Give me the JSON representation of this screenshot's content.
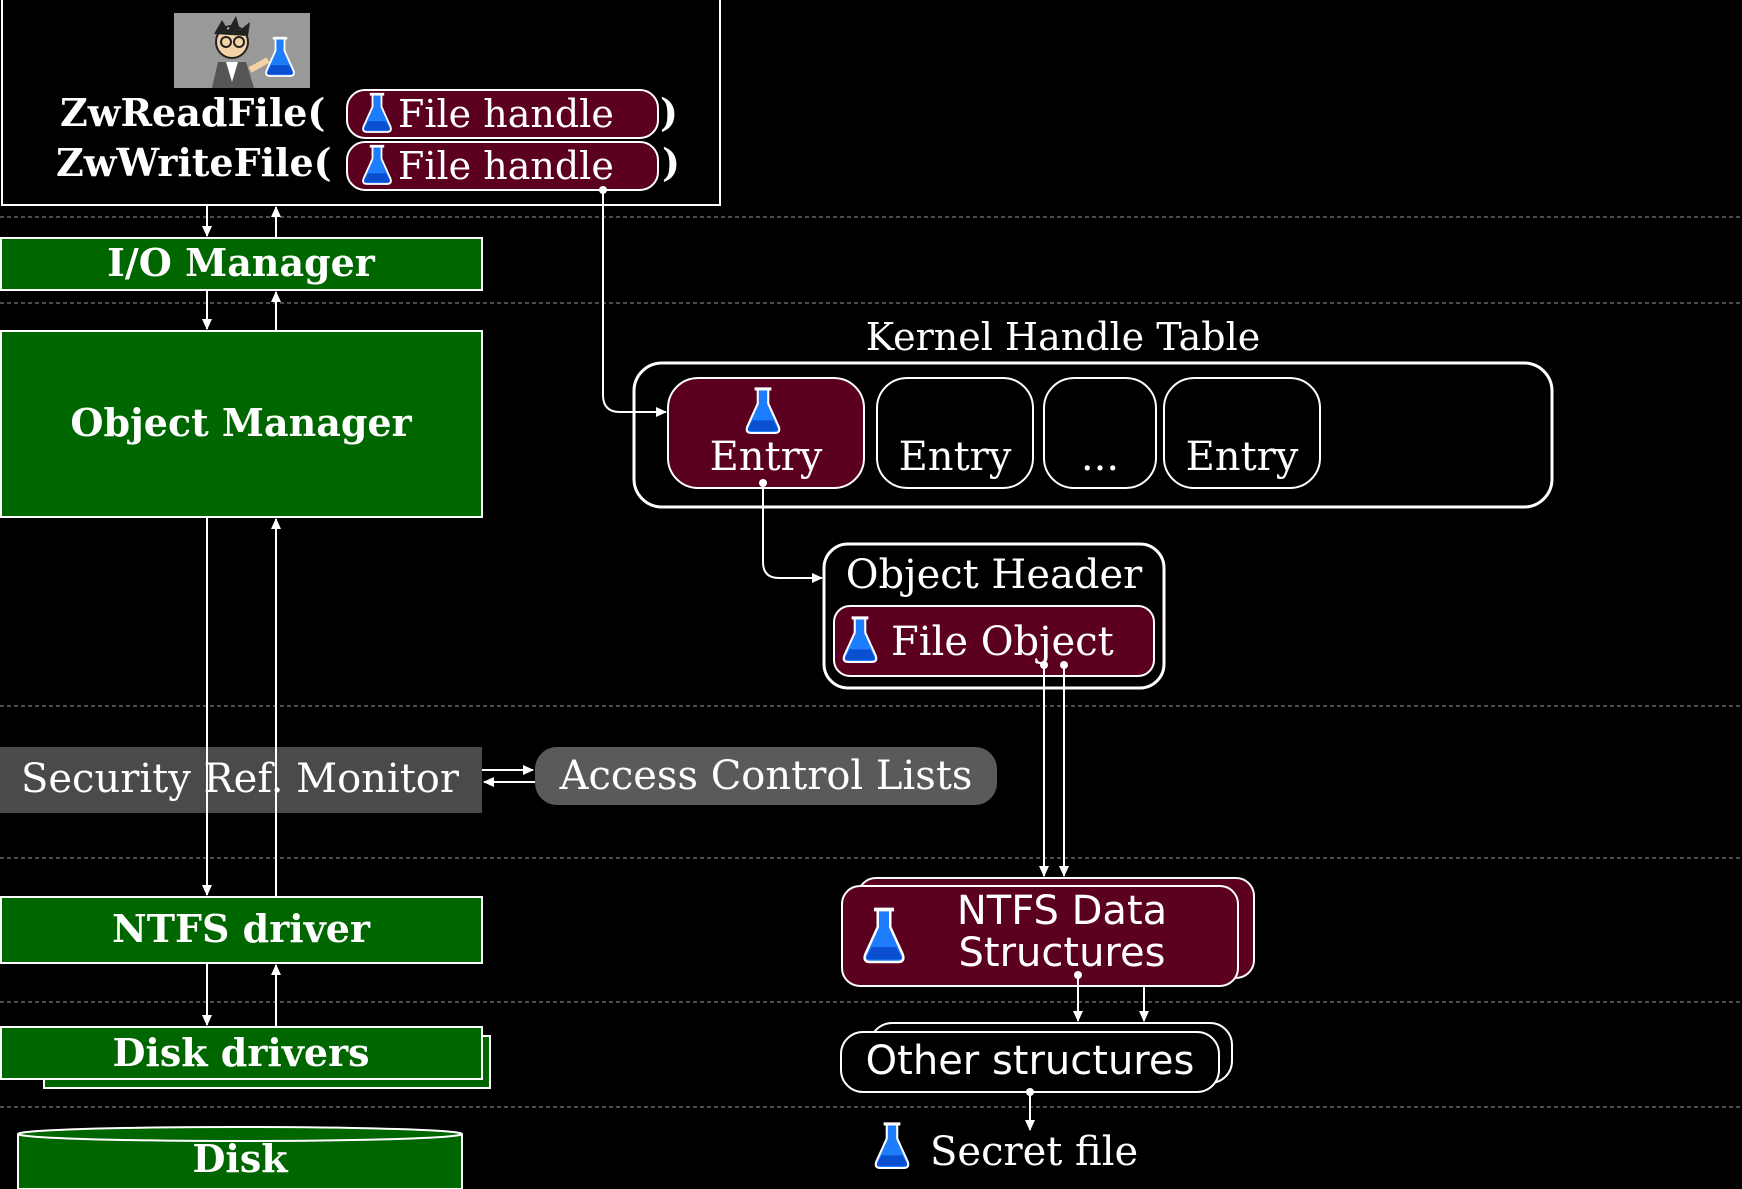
{
  "calls": {
    "read_func": "ZwReadFile(",
    "write_func": "ZwWriteFile(",
    "handle_label": "File handle",
    "close_paren": ")"
  },
  "layers": {
    "io_manager": "I/O Manager",
    "object_manager": "Object Manager",
    "security_monitor": "Security Ref. Monitor",
    "ntfs_driver": "NTFS driver",
    "disk_drivers": "Disk drivers",
    "disk": "Disk"
  },
  "handle_table": {
    "title": "Kernel Handle Table",
    "entries": [
      "Entry",
      "Entry",
      "...",
      "Entry"
    ]
  },
  "object_header": {
    "title": "Object Header",
    "file_object": "File Object"
  },
  "acl": "Access Control Lists",
  "ntfs_data": {
    "line1": "NTFS Data",
    "line2": "Structures"
  },
  "other_structures": "Other structures",
  "secret_file": "Secret file",
  "colors": {
    "background": "#000000",
    "layer_green": "#006600",
    "handle_maroon": "#5c0020",
    "security_gray": "#4a4a4a",
    "acl_gray": "#5a5a5a",
    "flask_blue": "#1e7cff"
  },
  "icons": [
    "cartoon-avatar",
    "flask-icon"
  ]
}
